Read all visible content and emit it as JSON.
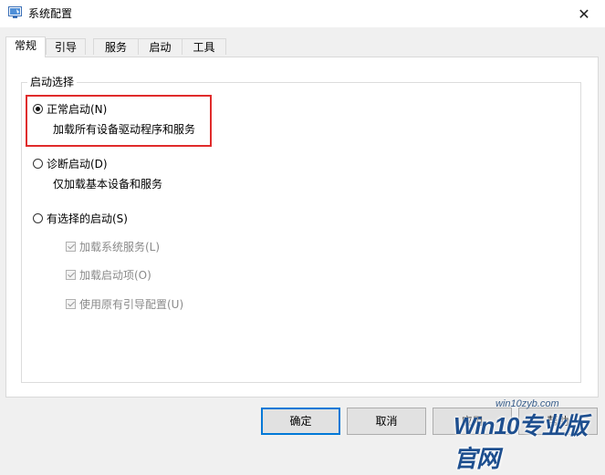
{
  "window": {
    "title": "系统配置",
    "close_icon": "✕",
    "icon_name": "system-config-icon"
  },
  "tabs": [
    {
      "label": "常规",
      "active": true
    },
    {
      "label": "引导",
      "active": false
    },
    {
      "label": "服务",
      "active": false
    },
    {
      "label": "启动",
      "active": false
    },
    {
      "label": "工具",
      "active": false
    }
  ],
  "startup_group": {
    "legend": "启动选择",
    "options": [
      {
        "label": "正常启动(N)",
        "description": "加载所有设备驱动程序和服务",
        "checked": true
      },
      {
        "label": "诊断启动(D)",
        "description": "仅加载基本设备和服务",
        "checked": false
      },
      {
        "label": "有选择的启动(S)",
        "description": "",
        "checked": false
      }
    ],
    "selective_items": [
      {
        "label": "加载系统服务(L)",
        "checked": true,
        "disabled": true
      },
      {
        "label": "加载启动项(O)",
        "checked": true,
        "disabled": true
      },
      {
        "label": "使用原有引导配置(U)",
        "checked": true,
        "disabled": true
      }
    ]
  },
  "buttons": {
    "ok": "确定",
    "cancel": "取消",
    "apply": "应用",
    "help": "帮助"
  },
  "watermark": {
    "url": "win10zyb.com",
    "text": "Win10专业版官网"
  },
  "colors": {
    "highlight": "#e02b2b",
    "default_button_border": "#0078d7"
  }
}
